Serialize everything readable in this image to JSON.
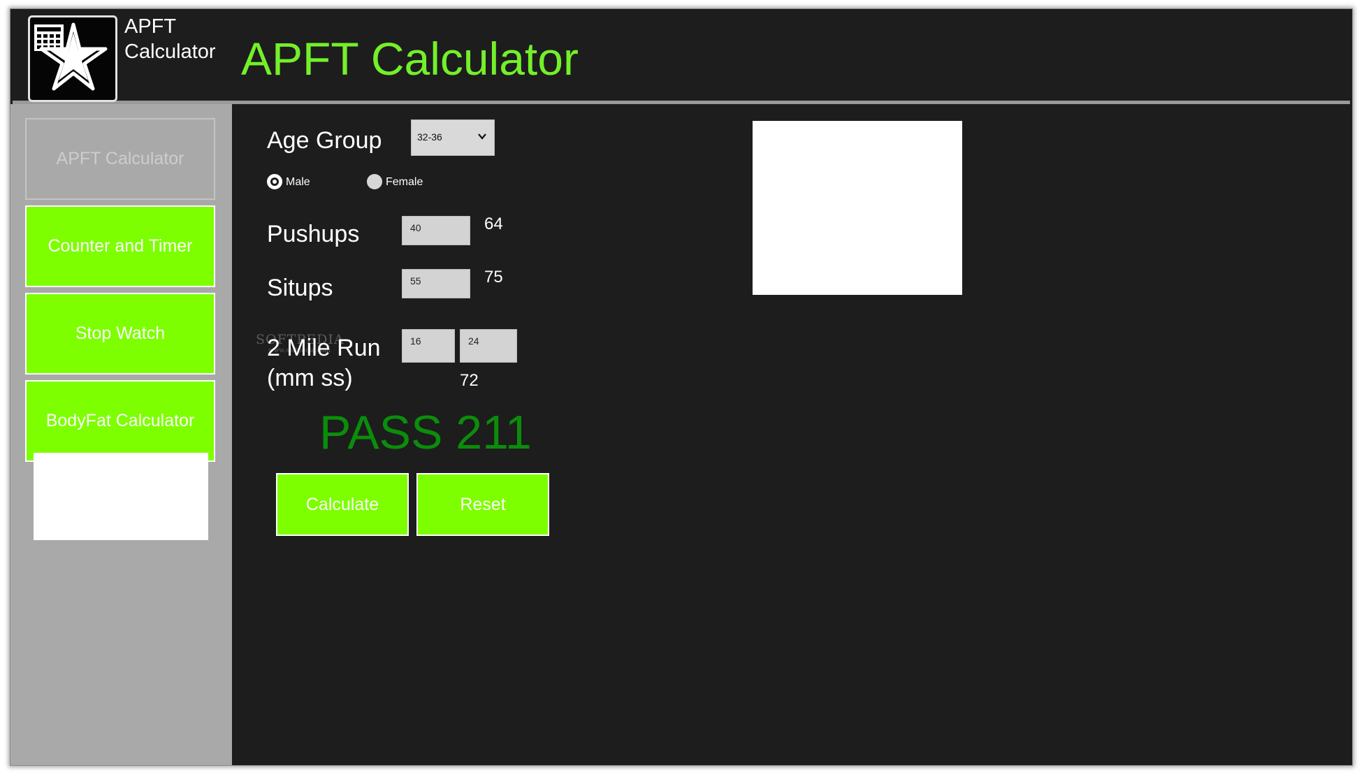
{
  "header": {
    "app_name_line1": "APFT",
    "app_name_line2": "Calculator",
    "title": "APFT Calculator",
    "icon": "calculator-star-icon"
  },
  "sidebar": {
    "items": [
      {
        "label": "APFT Calculator",
        "state": "disabled"
      },
      {
        "label": "Counter and Timer",
        "state": "enabled"
      },
      {
        "label": "Stop Watch",
        "state": "enabled"
      },
      {
        "label": "BodyFat Calculator",
        "state": "enabled"
      }
    ]
  },
  "form": {
    "age_group_label": "Age Group",
    "age_group_value": "32-36",
    "gender": {
      "male_label": "Male",
      "female_label": "Female",
      "selected": "Male"
    },
    "pushups": {
      "label": "Pushups",
      "value": "40",
      "score": "64"
    },
    "situps": {
      "label": "Situps",
      "value": "55",
      "score": "75"
    },
    "run": {
      "label_line1": "2 Mile Run",
      "label_line2": "(mm ss)",
      "minutes": "16",
      "seconds": "24",
      "score": "72"
    },
    "result": "PASS 211",
    "calculate_label": "Calculate",
    "reset_label": "Reset"
  },
  "watermark": {
    "text": "SOFTPEDIA",
    "url": "www.softpedia.com"
  },
  "colors": {
    "accent_green": "#7dff00",
    "title_green": "#74f02a",
    "pass_green": "#0b8d0b",
    "background": "#1d1d1d",
    "sidebar": "#a9a9a9"
  }
}
